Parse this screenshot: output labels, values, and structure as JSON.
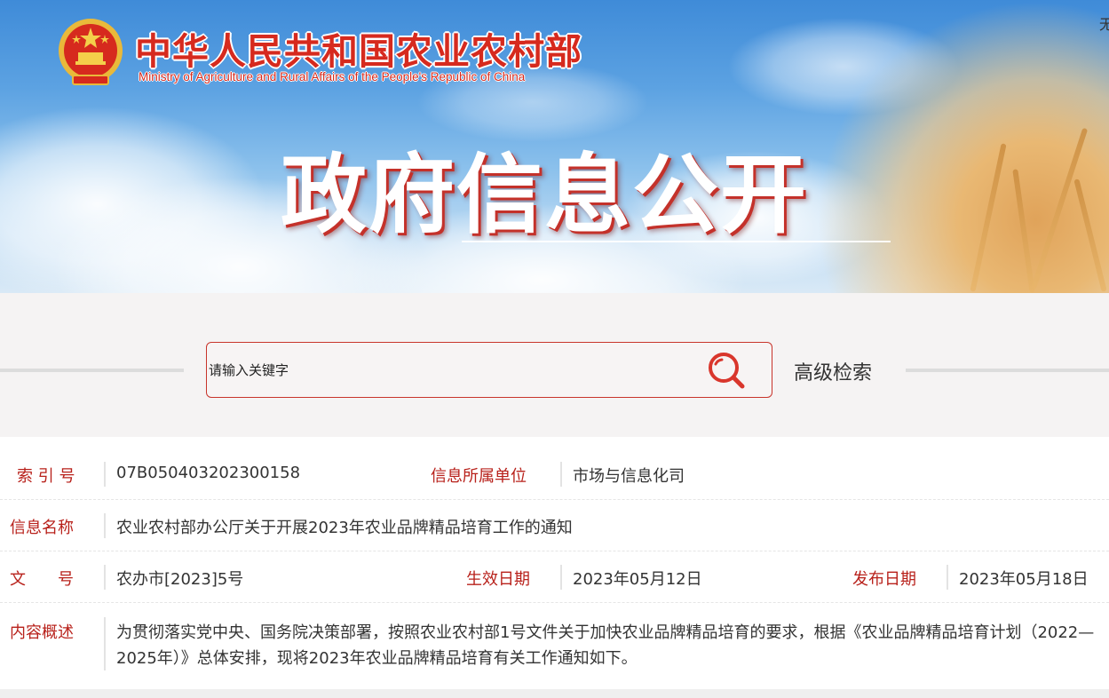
{
  "header": {
    "ministry_cn": "中华人民共和国农业农村部",
    "ministry_en": "Ministry of Agriculture and Rural Affairs of the People's Republic of China",
    "corner_text": "无",
    "page_title": "政府信息公开",
    "brand_red": "#d62a1e"
  },
  "search": {
    "placeholder": "请输入关键字",
    "value": "",
    "advanced_label": "高级检索",
    "icon": "search-icon",
    "border_color": "#c8342b"
  },
  "info": {
    "index": {
      "label": "索 引 号",
      "value": "07B050403202300158"
    },
    "department": {
      "label": "信息所属单位",
      "value": "市场与信息化司"
    },
    "name": {
      "label": "信息名称",
      "value": "农业农村部办公厅关于开展2023年农业品牌精品培育工作的通知"
    },
    "doc_no": {
      "label": "文　　号",
      "value": "农办市[2023]5号"
    },
    "effective_date": {
      "label": "生效日期",
      "value": "2023年05月12日"
    },
    "publish_date": {
      "label": "发布日期",
      "value": "2023年05月18日"
    },
    "summary": {
      "label": "内容概述",
      "value": "为贯彻落实党中央、国务院决策部署，按照农业农村部1号文件关于加快农业品牌精品培育的要求，根据《农业品牌精品培育计划（2022—2025年）》总体安排，现将2023年农业品牌精品培育有关工作通知如下。"
    },
    "label_color": "#b8211b"
  }
}
